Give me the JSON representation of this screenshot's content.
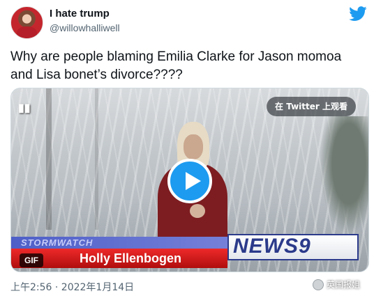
{
  "author": {
    "display_name": "I hate trump",
    "handle": "@willowhalliwell"
  },
  "tweet": {
    "text_line1": "Why are people blaming Emilia Clarke for Jason momoa",
    "text_line2": "and Lisa bonet’s divorce????",
    "timestamp": "上午2:56 · 2022年1月14日"
  },
  "media": {
    "watch_on_twitter": "在 Twitter 上观看",
    "gif_label": "GIF",
    "play_icon": "play-icon",
    "video_overlay": {
      "stormwatch": "STORMWATCH",
      "reporter_name": "Holly Ellenbogen",
      "channel": "NEWS9"
    }
  },
  "watermark": {
    "text": "英国报姐"
  },
  "colors": {
    "twitter_blue": "#1d9bf0",
    "secondary_text": "#536471"
  }
}
